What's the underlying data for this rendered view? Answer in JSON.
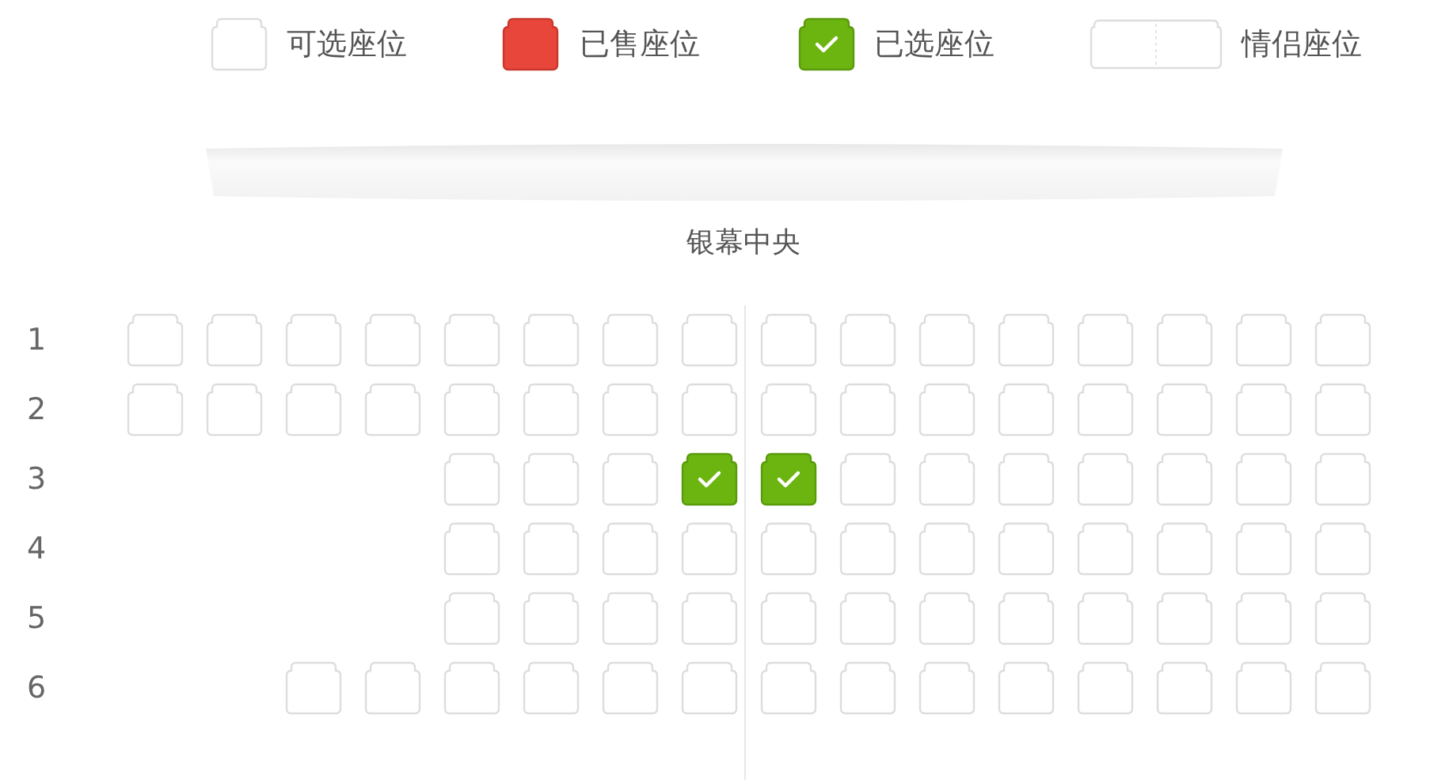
{
  "legend": [
    {
      "kind": "available",
      "label": "可选座位"
    },
    {
      "kind": "sold",
      "label": "已售座位"
    },
    {
      "kind": "selected",
      "label": "已选座位"
    },
    {
      "kind": "couple",
      "label": "情侣座位"
    }
  ],
  "screen": {
    "label": "银幕中央"
  },
  "rows": [
    {
      "label": "1",
      "seats": [
        {
          "kind": "seat",
          "selected": false
        },
        {
          "kind": "seat",
          "selected": false
        },
        {
          "kind": "seat",
          "selected": false
        },
        {
          "kind": "seat",
          "selected": false
        },
        {
          "kind": "seat",
          "selected": false
        },
        {
          "kind": "seat",
          "selected": false
        },
        {
          "kind": "seat",
          "selected": false
        },
        {
          "kind": "seat",
          "selected": false
        },
        {
          "kind": "seat",
          "selected": false
        },
        {
          "kind": "seat",
          "selected": false
        },
        {
          "kind": "seat",
          "selected": false
        },
        {
          "kind": "seat",
          "selected": false
        },
        {
          "kind": "seat",
          "selected": false
        },
        {
          "kind": "seat",
          "selected": false
        },
        {
          "kind": "seat",
          "selected": false
        },
        {
          "kind": "seat",
          "selected": false
        }
      ]
    },
    {
      "label": "2",
      "seats": [
        {
          "kind": "seat",
          "selected": false
        },
        {
          "kind": "seat",
          "selected": false
        },
        {
          "kind": "seat",
          "selected": false
        },
        {
          "kind": "seat",
          "selected": false
        },
        {
          "kind": "seat",
          "selected": false
        },
        {
          "kind": "seat",
          "selected": false
        },
        {
          "kind": "seat",
          "selected": false
        },
        {
          "kind": "seat",
          "selected": false
        },
        {
          "kind": "seat",
          "selected": false
        },
        {
          "kind": "seat",
          "selected": false
        },
        {
          "kind": "seat",
          "selected": false
        },
        {
          "kind": "seat",
          "selected": false
        },
        {
          "kind": "seat",
          "selected": false
        },
        {
          "kind": "seat",
          "selected": false
        },
        {
          "kind": "seat",
          "selected": false
        },
        {
          "kind": "seat",
          "selected": false
        }
      ]
    },
    {
      "label": "3",
      "seats": [
        {
          "kind": "gap"
        },
        {
          "kind": "gap"
        },
        {
          "kind": "gap"
        },
        {
          "kind": "gap"
        },
        {
          "kind": "seat",
          "selected": false
        },
        {
          "kind": "seat",
          "selected": false
        },
        {
          "kind": "seat",
          "selected": false
        },
        {
          "kind": "seat",
          "selected": true
        },
        {
          "kind": "seat",
          "selected": true
        },
        {
          "kind": "seat",
          "selected": false
        },
        {
          "kind": "seat",
          "selected": false
        },
        {
          "kind": "seat",
          "selected": false
        },
        {
          "kind": "seat",
          "selected": false
        },
        {
          "kind": "seat",
          "selected": false
        },
        {
          "kind": "seat",
          "selected": false
        },
        {
          "kind": "seat",
          "selected": false
        }
      ]
    },
    {
      "label": "4",
      "seats": [
        {
          "kind": "gap"
        },
        {
          "kind": "gap"
        },
        {
          "kind": "gap"
        },
        {
          "kind": "gap"
        },
        {
          "kind": "seat",
          "selected": false
        },
        {
          "kind": "seat",
          "selected": false
        },
        {
          "kind": "seat",
          "selected": false
        },
        {
          "kind": "seat",
          "selected": false
        },
        {
          "kind": "seat",
          "selected": false
        },
        {
          "kind": "seat",
          "selected": false
        },
        {
          "kind": "seat",
          "selected": false
        },
        {
          "kind": "seat",
          "selected": false
        },
        {
          "kind": "seat",
          "selected": false
        },
        {
          "kind": "seat",
          "selected": false
        },
        {
          "kind": "seat",
          "selected": false
        },
        {
          "kind": "seat",
          "selected": false
        }
      ]
    },
    {
      "label": "5",
      "seats": [
        {
          "kind": "gap"
        },
        {
          "kind": "gap"
        },
        {
          "kind": "gap"
        },
        {
          "kind": "gap"
        },
        {
          "kind": "seat",
          "selected": false
        },
        {
          "kind": "seat",
          "selected": false
        },
        {
          "kind": "seat",
          "selected": false
        },
        {
          "kind": "seat",
          "selected": false
        },
        {
          "kind": "seat",
          "selected": false
        },
        {
          "kind": "seat",
          "selected": false
        },
        {
          "kind": "seat",
          "selected": false
        },
        {
          "kind": "seat",
          "selected": false
        },
        {
          "kind": "seat",
          "selected": false
        },
        {
          "kind": "seat",
          "selected": false
        },
        {
          "kind": "seat",
          "selected": false
        },
        {
          "kind": "seat",
          "selected": false
        }
      ]
    },
    {
      "label": "6",
      "seats": [
        {
          "kind": "gap"
        },
        {
          "kind": "gap"
        },
        {
          "kind": "seat",
          "selected": false
        },
        {
          "kind": "seat",
          "selected": false
        },
        {
          "kind": "seat",
          "selected": false
        },
        {
          "kind": "seat",
          "selected": false
        },
        {
          "kind": "seat",
          "selected": false
        },
        {
          "kind": "seat",
          "selected": false
        },
        {
          "kind": "seat",
          "selected": false
        },
        {
          "kind": "seat",
          "selected": false
        },
        {
          "kind": "seat",
          "selected": false
        },
        {
          "kind": "seat",
          "selected": false
        },
        {
          "kind": "seat",
          "selected": false
        },
        {
          "kind": "seat",
          "selected": false
        },
        {
          "kind": "seat",
          "selected": false
        },
        {
          "kind": "seat",
          "selected": false
        }
      ]
    }
  ]
}
